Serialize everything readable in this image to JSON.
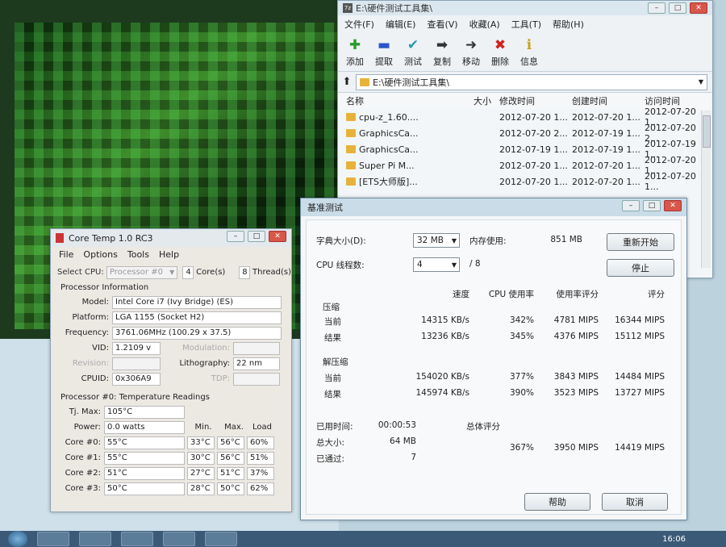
{
  "explorer": {
    "title": "E:\\硬件测试工具集\\",
    "menu": [
      "文件(F)",
      "编辑(E)",
      "查看(V)",
      "收藏(A)",
      "工具(T)",
      "帮助(H)"
    ],
    "toolbar": [
      {
        "label": "添加",
        "icon": "add-icon",
        "color": "#2a9a2a"
      },
      {
        "label": "提取",
        "icon": "extract-icon",
        "color": "#2d55c8"
      },
      {
        "label": "测试",
        "icon": "test-icon",
        "color": "#2b9aa8"
      },
      {
        "label": "复制",
        "icon": "copy-icon",
        "color": "#333333"
      },
      {
        "label": "移动",
        "icon": "move-icon",
        "color": "#333333"
      },
      {
        "label": "删除",
        "icon": "delete-icon",
        "color": "#d22222"
      },
      {
        "label": "信息",
        "icon": "info-icon",
        "color": "#c9a215"
      }
    ],
    "address": "E:\\硬件测试工具集\\",
    "columns": {
      "name": "名称",
      "size": "大小",
      "modified": "修改时间",
      "created": "创建时间",
      "accessed": "访问时间"
    },
    "rows": [
      {
        "name": "cpu-z_1.60....",
        "size": "",
        "modified": "2012-07-20 1...",
        "created": "2012-07-20 1...",
        "accessed": "2012-07-20 1..."
      },
      {
        "name": "GraphicsCa...",
        "size": "",
        "modified": "2012-07-20 2...",
        "created": "2012-07-19 1...",
        "accessed": "2012-07-20 2..."
      },
      {
        "name": "GraphicsCa...",
        "size": "",
        "modified": "2012-07-19 1...",
        "created": "2012-07-19 1...",
        "accessed": "2012-07-19 1..."
      },
      {
        "name": "Super Pi M...",
        "size": "",
        "modified": "2012-07-20 1...",
        "created": "2012-07-20 1...",
        "accessed": "2012-07-20 1..."
      },
      {
        "name": "[ETS大师版]...",
        "size": "",
        "modified": "2012-07-20 1...",
        "created": "2012-07-20 1...",
        "accessed": "2012-07-20 1..."
      }
    ]
  },
  "coretemp": {
    "title": "Core Temp 1.0 RC3",
    "menu": [
      "File",
      "Options",
      "Tools",
      "Help"
    ],
    "select_cpu_label": "Select CPU:",
    "select_cpu_value": "Processor #0",
    "cores_value": "4",
    "cores_label": "Core(s)",
    "threads_value": "8",
    "threads_label": "Thread(s)",
    "proc_info_heading": "Processor Information",
    "model_label": "Model:",
    "model_value": "Intel Core i7 (Ivy Bridge)  (ES)",
    "platform_label": "Platform:",
    "platform_value": "LGA 1155 (Socket H2)",
    "frequency_label": "Frequency:",
    "frequency_value": "3761.06MHz (100.29 x 37.5)",
    "vid_label": "VID:",
    "vid_value": "1.2109 v",
    "modulation_label": "Modulation:",
    "revision_label": "Revision:",
    "lithography_label": "Lithography:",
    "lithography_value": "22 nm",
    "cpuid_label": "CPUID:",
    "cpuid_value": "0x306A9",
    "tdp_label": "TDP:",
    "temp_heading": "Processor #0: Temperature Readings",
    "tjmax_label": "Tj. Max:",
    "tjmax_value": "105°C",
    "power_label": "Power:",
    "power_value": "0.0 watts",
    "col_min": "Min.",
    "col_max": "Max.",
    "col_load": "Load",
    "cores": [
      {
        "label": "Core #0:",
        "temp": "55°C",
        "min": "33°C",
        "max": "56°C",
        "load": "60%"
      },
      {
        "label": "Core #1:",
        "temp": "55°C",
        "min": "30°C",
        "max": "56°C",
        "load": "51%"
      },
      {
        "label": "Core #2:",
        "temp": "51°C",
        "min": "27°C",
        "max": "51°C",
        "load": "37%"
      },
      {
        "label": "Core #3:",
        "temp": "50°C",
        "min": "28°C",
        "max": "50°C",
        "load": "62%"
      }
    ]
  },
  "bench": {
    "title": "基准测试",
    "dict_label": "字典大小(D):",
    "dict_value": "32 MB",
    "mem_label": "内存使用:",
    "mem_value": "851 MB",
    "threads_label": "CPU 线程数:",
    "threads_value": "4",
    "threads_total": "/ 8",
    "restart_button": "重新开始",
    "stop_button": "停止",
    "headers": {
      "speed": "速度",
      "cpu": "CPU 使用率",
      "rating": "使用率评分",
      "score": "评分"
    },
    "compress_heading": "压缩",
    "decompress_heading": "解压缩",
    "current_label": "当前",
    "result_label": "结果",
    "compress": {
      "current": {
        "speed": "14315 KB/s",
        "cpu": "342%",
        "rating": "4781 MIPS",
        "score": "16344 MIPS"
      },
      "result": {
        "speed": "13236 KB/s",
        "cpu": "345%",
        "rating": "4376 MIPS",
        "score": "15112 MIPS"
      }
    },
    "decompress": {
      "current": {
        "speed": "154020 KB/s",
        "cpu": "377%",
        "rating": "3843 MIPS",
        "score": "14484 MIPS"
      },
      "result": {
        "speed": "145974 KB/s",
        "cpu": "390%",
        "rating": "3523 MIPS",
        "score": "13727 MIPS"
      }
    },
    "elapsed_label": "已用时间:",
    "elapsed_value": "00:00:53",
    "total_size_label": "总大小:",
    "total_size_value": "64 MB",
    "passed_label": "已通过:",
    "passed_value": "7",
    "overall_label": "总体评分",
    "overall": {
      "cpu": "367%",
      "rating": "3950 MIPS",
      "score": "14419 MIPS"
    },
    "help_button": "帮助",
    "cancel_button": "取消"
  },
  "taskbar": {
    "clock": "16:06"
  }
}
